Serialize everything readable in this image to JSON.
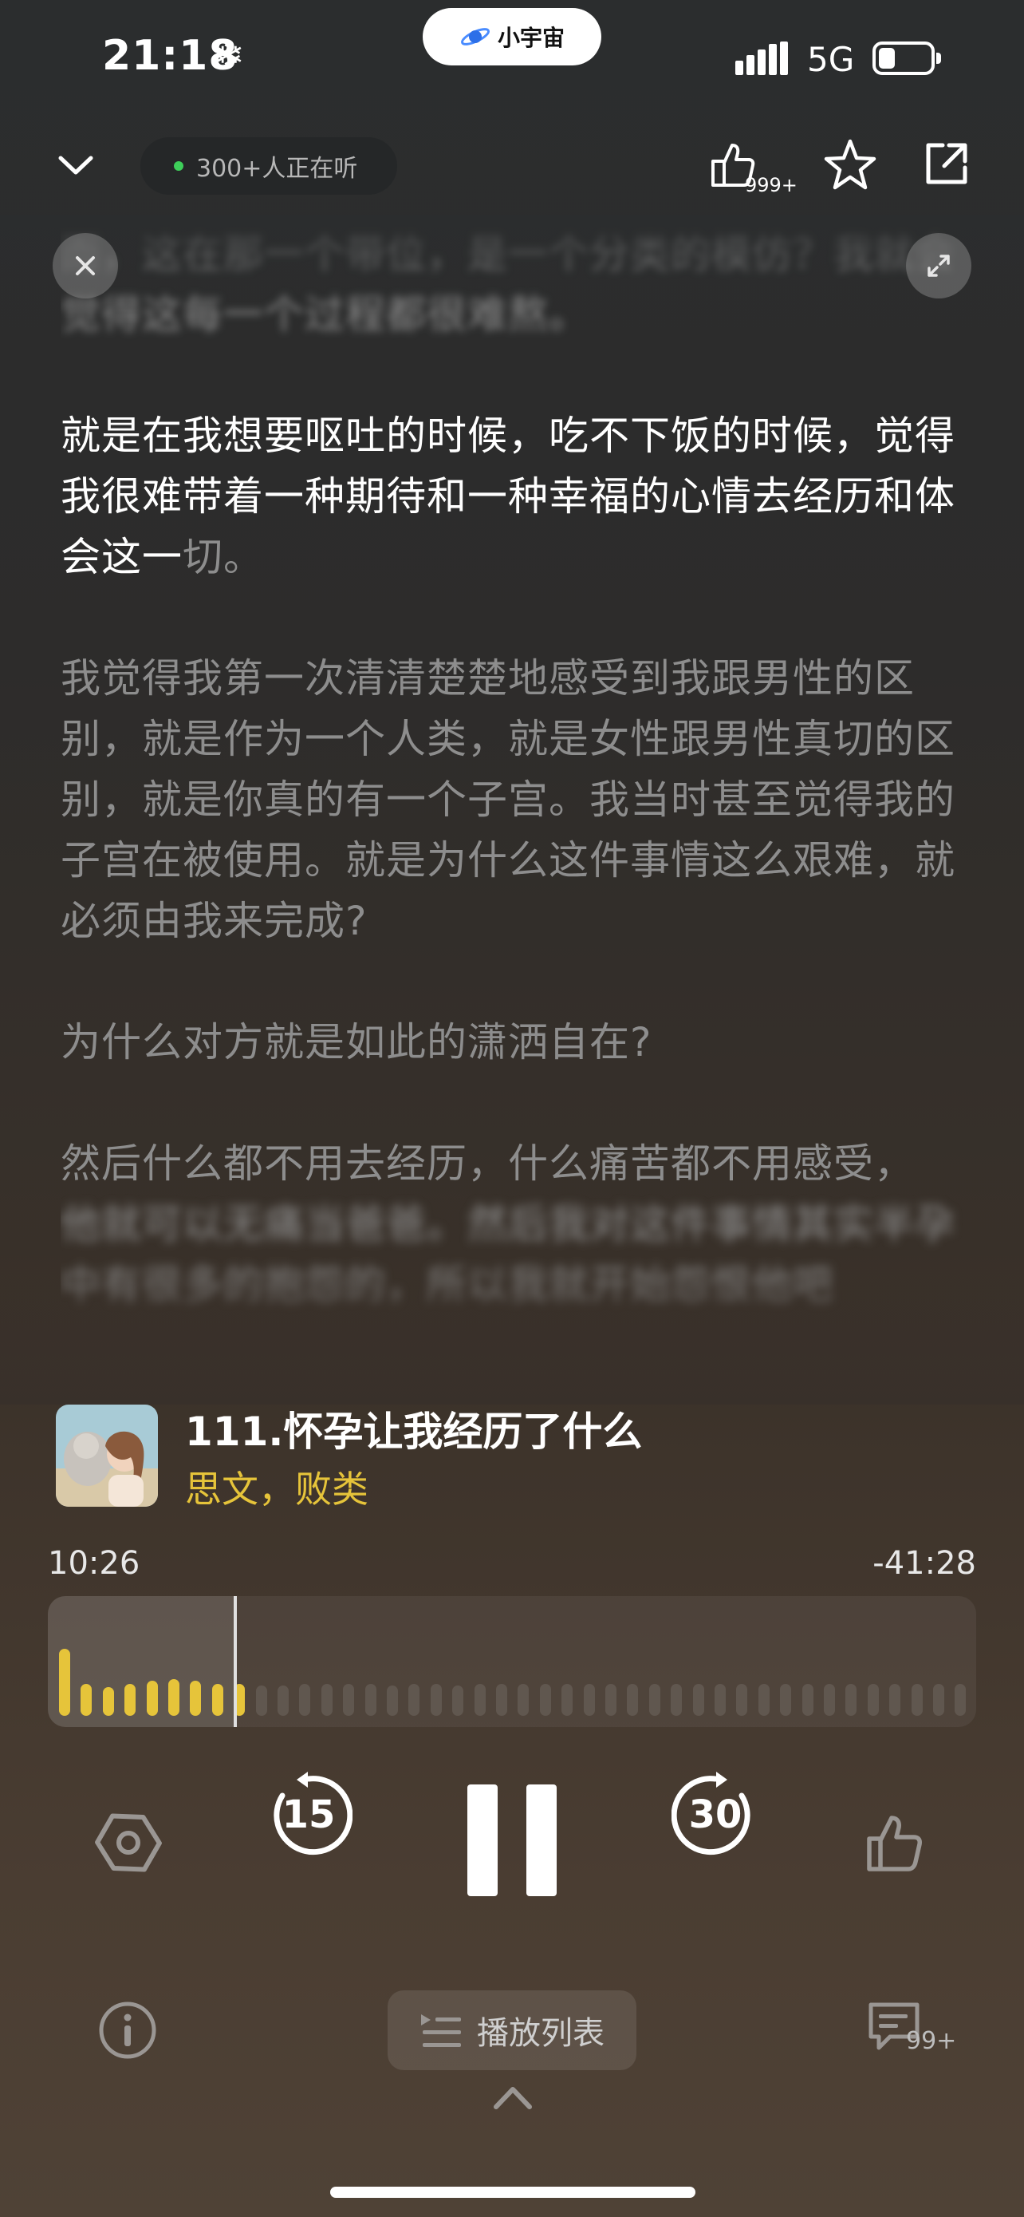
{
  "status_bar": {
    "time": "21:18",
    "snow_glyph": "❄",
    "island_label": "小宇宙",
    "network": "5G"
  },
  "header": {
    "listening_label": "300+人正在听",
    "like_count": "999+"
  },
  "transcript": {
    "para_top_blur": "而，这在那一个带位，是一个分类的模仿？我就会觉得这每一个过程都很难熬。",
    "para_active_lit": "就是在我想要呕吐的时候，吃不下饭的时候，觉得我很难带着一种期待和一种幸福的心情去经历和体会这一",
    "para_active_unlit": "切。",
    "para_2": "我觉得我第一次清清楚楚地感受到我跟男性的区别，就是作为一个人类，就是女性跟男性真切的区别，就是你真的有一个子宫。我当时甚至觉得我的子宫在被使用。就是为什么这件事情这么艰难，就必须由我来完成?",
    "para_3": "为什么对方就是如此的潇洒自在?",
    "para_4_line1": "然后什么都不用去经历，什么痛苦都不用感受，",
    "para_4_blur": "他就可以无痛当爸爸。然后我对这件事情其实半孕中有很多的抱怨的，所以我就开始怨恨他吧"
  },
  "episode": {
    "title": "111.怀孕让我经历了什么",
    "author": "思文，败类"
  },
  "progress": {
    "elapsed": "10:26",
    "remaining": "-41:28",
    "fraction": 0.202
  },
  "controls": {
    "rewind_seconds": "15",
    "forward_seconds": "30",
    "playlist_label": "播放列表",
    "comment_count": "99+"
  },
  "colors": {
    "accent": "#e6c43a",
    "live_dot": "#3ecf5a"
  }
}
